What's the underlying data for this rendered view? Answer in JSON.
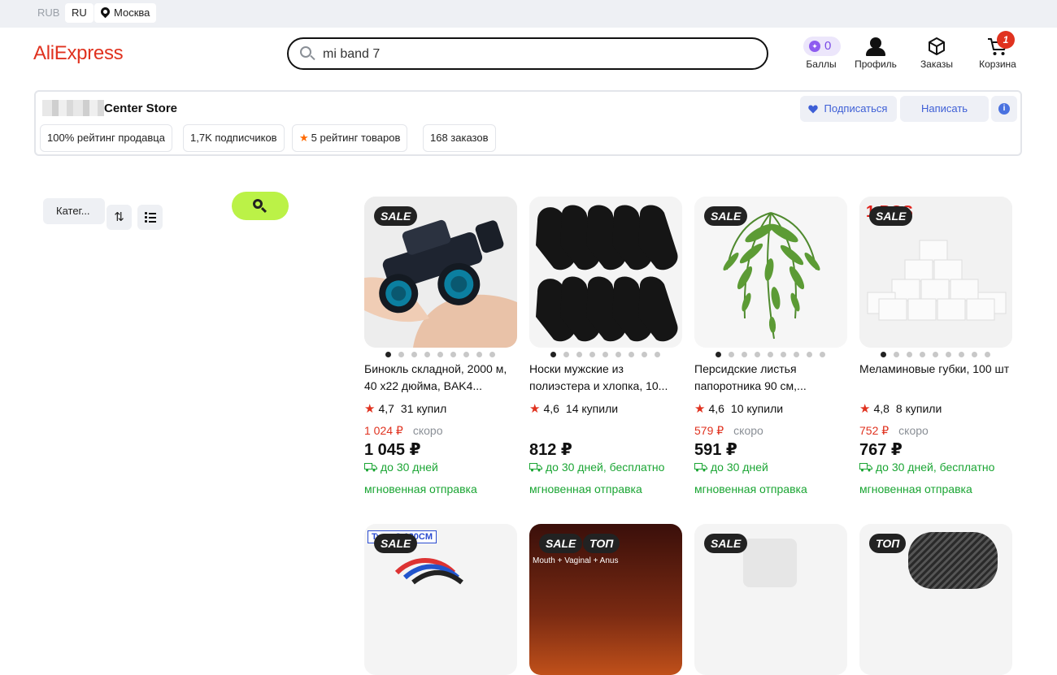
{
  "topbar": {
    "currency": "RUB",
    "language": "RU",
    "city": "Москва"
  },
  "header": {
    "logo": "AliExpress",
    "search_value": "mi band 7",
    "points_count": "0",
    "points_label": "Баллы",
    "profile_label": "Профиль",
    "orders_label": "Заказы",
    "cart_label": "Корзина",
    "cart_count": "1"
  },
  "store": {
    "name": "Center Store",
    "subscribe_label": "Подписаться",
    "write_label": "Написать",
    "info_icon": "i",
    "chips": [
      "100% рейтинг продавца",
      "1,7K подписчиков",
      "5 рейтинг товаров",
      "168 заказов"
    ]
  },
  "filters": {
    "categories_label": "Катег...",
    "sort_icon": "⇅"
  },
  "products": [
    {
      "badge": "SALE",
      "title": "Бинокль складной, 2000 м, 40 х22 дюйма, BAK4...",
      "rating": "4,7",
      "sold": "31 купил",
      "old_price": "1 024 ₽",
      "soon": "скоро",
      "price": "1 045 ₽",
      "delivery": "до 30 дней",
      "instant": "мгновенная отправка"
    },
    {
      "badge": "",
      "title": "Носки мужские из полиэстера и хлопка, 10...",
      "rating": "4,6",
      "sold": "14 купили",
      "old_price": "",
      "soon": "",
      "price": "812 ₽",
      "delivery": "до 30 дней, бесплатно",
      "instant": "мгновенная отправка"
    },
    {
      "badge": "SALE",
      "title": "Персидские листья папоротника 90 см,...",
      "rating": "4,6",
      "sold": "10 купили",
      "old_price": "579 ₽",
      "soon": "скоро",
      "price": "591 ₽",
      "delivery": "до 30 дней",
      "instant": "мгновенная отправка"
    },
    {
      "badge": "SALE",
      "title": "Меламиновые губки, 100 шт",
      "rating": "4,8",
      "sold": "8 купили",
      "old_price": "752 ₽",
      "soon": "скоро",
      "price": "767 ₽",
      "delivery": "до 30 дней, бесплатно",
      "instant": "мгновенная отправка",
      "image_text": "1  PCS"
    }
  ],
  "products_row2": [
    {
      "badges": [
        "SALE"
      ],
      "image_text": "Type-C 120CM"
    },
    {
      "badges": [
        "SALE",
        "ТОП"
      ],
      "image_text": "Mouth + Vaginal + Anus"
    },
    {
      "badges": [
        "SALE"
      ]
    },
    {
      "badges": [
        "ТОП"
      ]
    }
  ],
  "colors": {
    "accent": "#e0321f",
    "green": "#1aa533",
    "search_green": "#bbf247",
    "link_blue": "#3e5fd6"
  }
}
